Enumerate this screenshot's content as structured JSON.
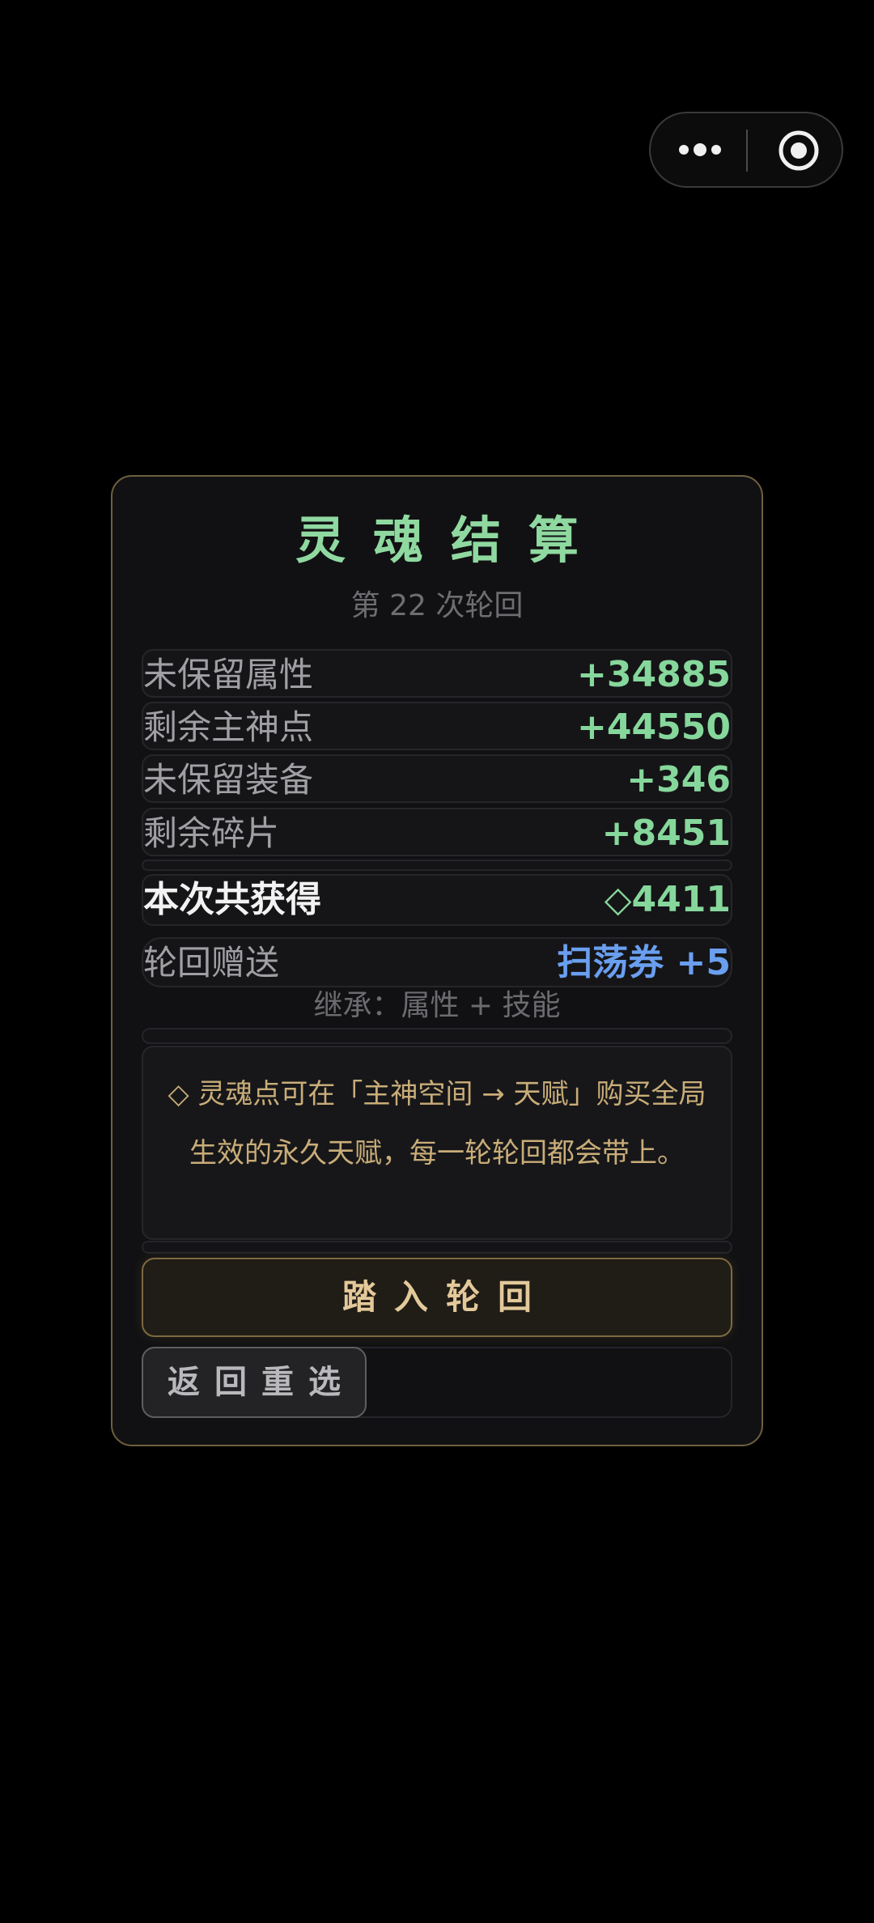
{
  "capsule": {
    "more_icon": "more-dots-icon",
    "close_icon": "target-close-icon"
  },
  "dialog": {
    "title": "灵魂结算",
    "subtitle": "第 22 次轮回",
    "rows": [
      {
        "label": "未保留属性",
        "value": "+34885"
      },
      {
        "label": "剩余主神点",
        "value": "+44550"
      },
      {
        "label": "未保留装备",
        "value": "+346"
      },
      {
        "label": "剩余碎片",
        "value": "+8451"
      }
    ],
    "total": {
      "label": "本次共获得",
      "value": "◇4411"
    },
    "gift": {
      "label": "轮回赠送",
      "value": "扫荡券 +5"
    },
    "inherit_text": "继承：属性 + 技能",
    "note": "◇ 灵魂点可在「主神空间 → 天赋」购买全局生效的永久天赋，每一轮轮回都会带上。",
    "enter_button": "踏入轮回",
    "back_button": "返回重选"
  },
  "colors": {
    "background": "#000000",
    "title_green": "#8fd9a0",
    "value_green": "#86d79b",
    "gift_blue": "#6a9ff0",
    "gold_text": "#c9ad78",
    "panel_border": "#6e5f3e"
  }
}
